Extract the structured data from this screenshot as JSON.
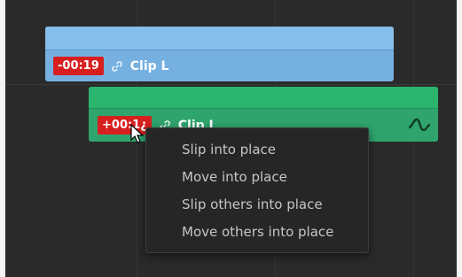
{
  "timeline": {
    "top_clip": {
      "offset": "-00:19",
      "name": "Clip L",
      "color": "#75b0e0"
    },
    "bottom_clip": {
      "offset": "+00:1¿",
      "name": "Clip L",
      "color": "#2fa56d"
    }
  },
  "context_menu": {
    "items": [
      {
        "label": "Slip into place"
      },
      {
        "label": "Move into place"
      },
      {
        "label": "Slip others into place"
      },
      {
        "label": "Move others into place"
      }
    ]
  },
  "icons": {
    "link": "link-icon",
    "audio_wave": "audio-wave-icon",
    "pointer": "mouse-pointer-icon"
  },
  "colors": {
    "badge_red": "#d81f1f",
    "timeline_bg": "#2a2a2a",
    "menu_bg": "#262626",
    "menu_text": "#c6c6c6"
  }
}
